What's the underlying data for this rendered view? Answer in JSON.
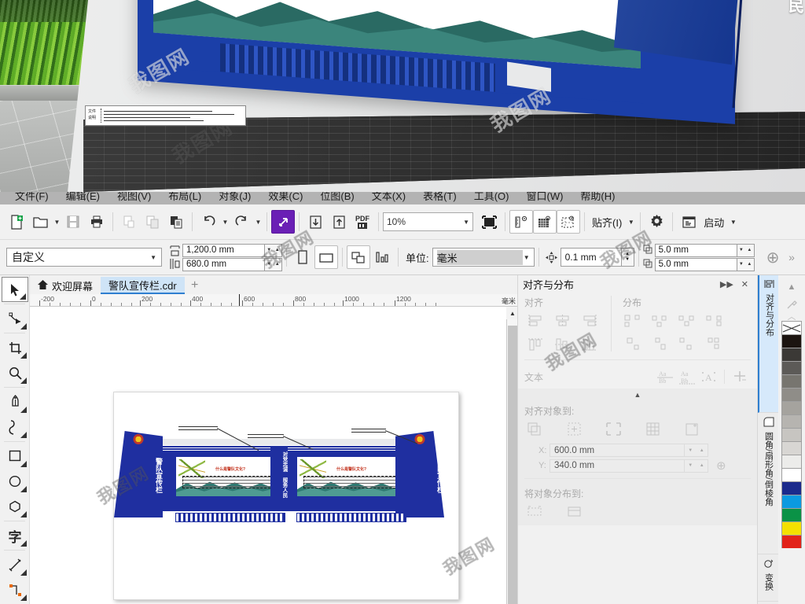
{
  "app": {
    "name": "CorelDRAW",
    "menu": [
      "文件(F)",
      "编辑(E)",
      "视图(V)",
      "布局(L)",
      "对象(J)",
      "效果(C)",
      "位图(B)",
      "文本(X)",
      "表格(T)",
      "工具(O)",
      "窗口(W)",
      "帮助(H)"
    ],
    "watermark": "我图网"
  },
  "toolbar": {
    "new": "新建",
    "open": "打开",
    "save": "保存",
    "print": "打印",
    "cut": "剪切",
    "copy": "复制",
    "paste": "粘贴",
    "undo": "撤消",
    "redo": "重做",
    "publish": "发布",
    "import": "导入",
    "export": "导出",
    "pdf": "PDF",
    "zoom_value": "10%",
    "fullscreen": "全屏预览",
    "show_rulers": "标尺",
    "show_grid": "网格",
    "show_guides": "辅助线",
    "snap_label": "贴齐(I)",
    "options_label": "选项",
    "launch_label": "启动"
  },
  "propbar": {
    "preset_name": "自定义",
    "page_width": "1,200.0 mm",
    "page_height": "680.0 mm",
    "portrait": "纵向",
    "landscape": "横向",
    "all_pages": "应用于所有页面",
    "current_page": "仅应用于当前页面",
    "unit_label": "单位:",
    "unit_value": "毫米",
    "nudge_label": "微调偏移",
    "nudge_value": "0.1 mm",
    "dup_x_label": "X",
    "dup_x_value": "5.0 mm",
    "dup_y_label": "Y",
    "dup_y_value": "5.0 mm",
    "add_label": "+",
    "more_label": "»"
  },
  "tabs": {
    "welcome": "欢迎屏幕",
    "document": "警队宣传栏.cdr",
    "add": "+"
  },
  "toolbox": [
    {
      "name": "pick-tool",
      "glyph": "➤",
      "label": "选择工具"
    },
    {
      "name": "shape-tool",
      "glyph": "⌁",
      "label": "形状工具"
    },
    {
      "name": "crop-tool",
      "glyph": "✛",
      "label": "裁剪工具"
    },
    {
      "name": "zoom-tool",
      "glyph": "🔍",
      "label": "缩放工具"
    },
    {
      "name": "pen-tool",
      "glyph": "✒",
      "label": "钢笔工具"
    },
    {
      "name": "freehand-tool",
      "glyph": "∿",
      "label": "手绘工具"
    },
    {
      "name": "rectangle-tool",
      "glyph": "▭",
      "label": "矩形工具"
    },
    {
      "name": "ellipse-tool",
      "glyph": "◯",
      "label": "椭圆形工具"
    },
    {
      "name": "polygon-tool",
      "glyph": "⬡",
      "label": "多边形工具"
    },
    {
      "name": "text-tool",
      "glyph": "字",
      "label": "文本工具"
    },
    {
      "name": "dimension-tool",
      "glyph": "↗",
      "label": "度量工具"
    },
    {
      "name": "connector-tool",
      "glyph": "⌐",
      "label": "连接器工具"
    }
  ],
  "ruler": {
    "unit": "毫米",
    "ticks": [
      "-200",
      "0",
      "200",
      "400",
      "600",
      "800",
      "1000",
      "1200"
    ]
  },
  "docker": {
    "title": "对齐与分布",
    "collapse_icon": "▶▶",
    "close_icon": "✕",
    "align_label": "对齐",
    "distribute_label": "分布",
    "text_label": "文本",
    "align_to_label": "对齐对象到:",
    "distribute_to_label": "将对象分布到:",
    "x_label": "X:",
    "x_value": "600.0 mm",
    "y_label": "Y:",
    "y_value": "340.0 mm",
    "collapse_caret": "▲"
  },
  "vtabs": [
    {
      "label": "对齐与分布",
      "glyph": "⫼",
      "active": true
    },
    {
      "label": "圆角/扇形角/倒棱角",
      "glyph": "◱",
      "active": false
    },
    {
      "label": "变换",
      "glyph": "⟳",
      "active": false
    }
  ],
  "palette": {
    "none_label": "无填充",
    "colors": [
      "#ffffff",
      "#1c1410",
      "#3b3936",
      "#5c5a57",
      "#77756f",
      "#8f8d88",
      "#a5a39e",
      "#b6b4b0",
      "#c7c5c1",
      "#d8d6d3",
      "#ececea",
      "#ffffff",
      "#1b2a8c",
      "#0b9ae0",
      "#0a9246",
      "#f4e000",
      "#e2231a"
    ]
  },
  "artwork": {
    "title": "警队宣传栏",
    "wing_left_text": "警队宣传栏",
    "wing_right_text": "警队宣传栏",
    "center_text": "对党忠诚 服务人民",
    "panel_title": "什么是警队文化?",
    "doc_label_1": "文件",
    "doc_label_2": "说明"
  },
  "photo": {
    "board_text": "服务人民"
  },
  "colors": {
    "accent": "#2f7fd0",
    "brand_blue": "#1f2fa0",
    "purple_btn": "#6a1fb5",
    "tab_active": "#cfe4f7"
  }
}
